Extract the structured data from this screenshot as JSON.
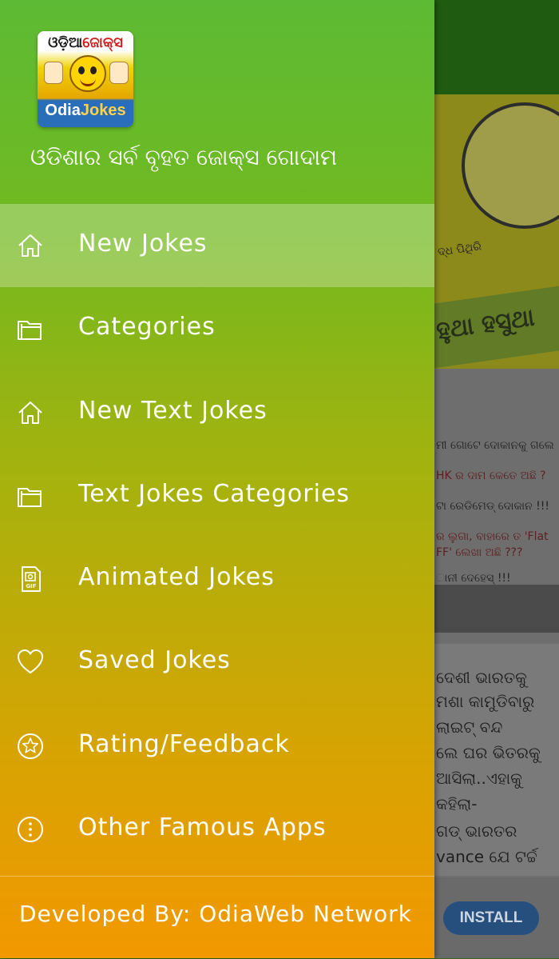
{
  "background_app": {
    "card1": {
      "sub_text": "ଦ୍ଧ ପିଥିରି",
      "band_text": "ହୁଥା ହସୁଥା"
    },
    "card2": {
      "lines": [
        "ମୀ ଗୋଟେ ଦୋକାନକୁ ଗଲେ ।",
        "HK ର ଦାମ କେତେ ଅଛି ?",
        "ଟା ରେଡିମେଡ୍ ଦୋକାନ !!!",
        "ର ଲୁଗା, ବାହାରେ ତ 'Flat",
        "FF' ଲେଖା ଅଛି ???",
        "ାନୀ ଦେହେସ୍ !!!"
      ]
    },
    "card3": {
      "lines": [
        "ଦେଶୀ ଭାରତକୁ",
        "ମଶା କାମୁଡିବାରୁ",
        "ଲାଇଟ୍ ବନ୍ଦ",
        "ଲେ ଘର ଭିତରକୁ",
        "ଆସିଲା..ଏହାକୁ",
        "କହିଲା-",
        "ଗଡ୍ ଭାରତର",
        "vance ଯେ ଟର୍ଚ୍ଚ"
      ]
    },
    "install_label": "INSTALL"
  },
  "drawer": {
    "logo": {
      "top_text_a": "ଓଡ଼ିଆ",
      "top_text_b": "ଜୋକ୍ସ",
      "bottom_text_a": "Odia",
      "bottom_text_b": "Jokes"
    },
    "tagline": "ଓଡିଶାର ସର୍ବ ବୃହତ ଜୋକ୍ସ ଗୋଦାମ",
    "active_index": 0,
    "items": [
      {
        "label": "New Jokes",
        "icon": "home-icon"
      },
      {
        "label": "Categories",
        "icon": "folder-icon"
      },
      {
        "label": "New Text Jokes",
        "icon": "home-icon"
      },
      {
        "label": "Text Jokes Categories",
        "icon": "folder-icon"
      },
      {
        "label": "Animated Jokes",
        "icon": "gif-file-icon"
      },
      {
        "label": "Saved Jokes",
        "icon": "heart-icon"
      },
      {
        "label": "Rating/Feedback",
        "icon": "star-icon"
      },
      {
        "label": "Other Famous Apps",
        "icon": "more-icon"
      }
    ],
    "footer": "Developed By: OdiaWeb Network"
  },
  "colors": {
    "drawer_top": "#5dba34",
    "drawer_bottom": "#f29800",
    "toolbar": "#1f5b10",
    "install": "#274f7e"
  }
}
